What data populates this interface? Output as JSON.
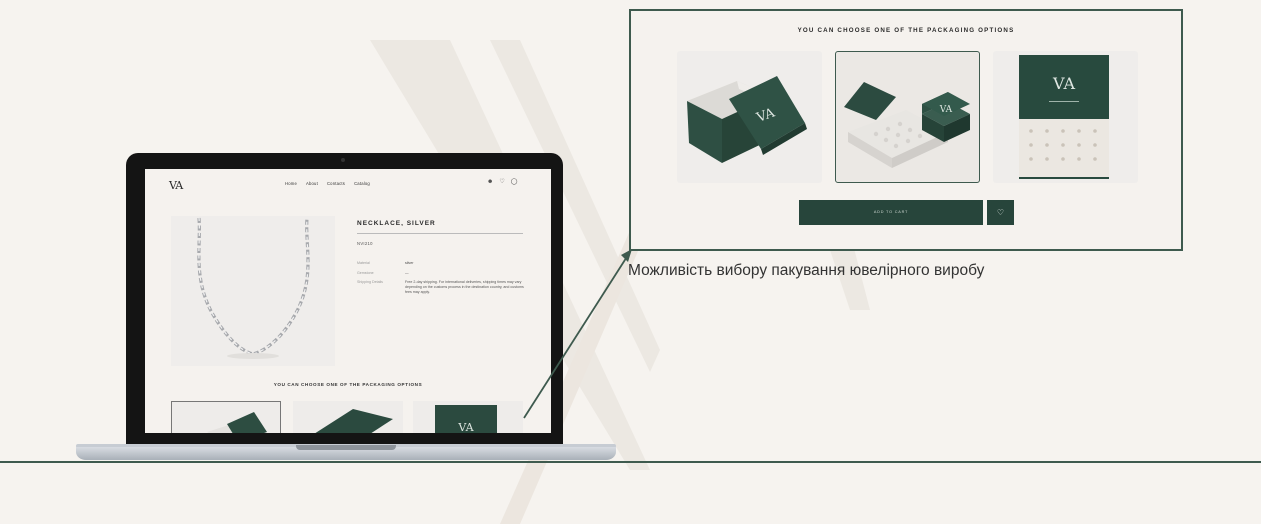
{
  "colors": {
    "background": "#f6f3ef",
    "brand_green": "#27453b",
    "frame_green": "#3e5a4e"
  },
  "laptop": {
    "logo": "VA",
    "nav": [
      "Home",
      "About",
      "Contacts",
      "Catalog"
    ],
    "icons": [
      "user-icon",
      "heart-icon",
      "cart-icon"
    ],
    "product_title": "NECKLACE, SILVER",
    "sku": "NVI210",
    "specs": [
      {
        "label": "Material",
        "value": "silver"
      },
      {
        "label": "Gemstone",
        "value": "—"
      },
      {
        "label": "Shipping Details",
        "value": ""
      }
    ],
    "shipping_text": "Free 2-day shipping. For international deliveries, shipping times may vary depending on the customs process in the destination country, and customs fees may apply.",
    "packaging_title": "YOU CAN CHOOSE ONE OF THE PACKAGING OPTIONS"
  },
  "zoom": {
    "title": "YOU CAN CHOOSE ONE OF THE PACKAGING OPTIONS",
    "options": [
      {
        "name": "open-lid-box",
        "selected": false
      },
      {
        "name": "hinged-box",
        "selected": true
      },
      {
        "name": "drawer-box",
        "selected": false
      }
    ],
    "add_to_cart": "ADD TO CART",
    "favorite_icon": "heart-icon"
  },
  "caption": "Можливість вибору пакування ювелірного виробу"
}
